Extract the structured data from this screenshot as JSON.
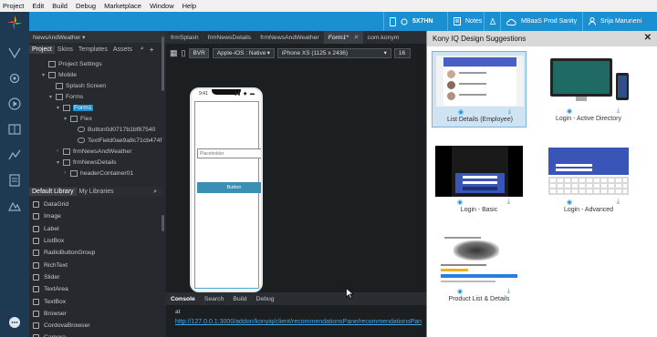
{
  "menubar": [
    "Project",
    "Edit",
    "Build",
    "Debug",
    "Marketplace",
    "Window",
    "Help"
  ],
  "header": {
    "device_code": "5X7HN",
    "notes_label": "Notes",
    "environment": "MBaaS Prod Sanity",
    "user": "Srija Maruneni"
  },
  "project": {
    "name": "NewsAndWeather",
    "tabs": [
      "Project",
      "Skins",
      "Templates",
      "Assets"
    ],
    "tree": [
      {
        "label": "Project Settings",
        "indent": 1,
        "caret": "",
        "icon": "sq"
      },
      {
        "label": "Mobile",
        "indent": 1,
        "caret": "▾",
        "icon": "sq"
      },
      {
        "label": "Splash Screen",
        "indent": 2,
        "caret": "",
        "icon": "sq"
      },
      {
        "label": "Forms",
        "indent": 2,
        "caret": "▾",
        "icon": "sq"
      },
      {
        "label": "Form1",
        "indent": 3,
        "caret": "▾",
        "icon": "sq",
        "selected": true
      },
      {
        "label": "Flex",
        "indent": 4,
        "caret": "▾",
        "icon": "sq"
      },
      {
        "label": "Button0d0717b1bf87540",
        "indent": 5,
        "caret": "",
        "icon": "rnd"
      },
      {
        "label": "TextField0ae9a8c71cb474f",
        "indent": 5,
        "caret": "",
        "icon": "rnd"
      },
      {
        "label": "frmNewsAndWeather",
        "indent": 3,
        "caret": "›",
        "icon": "sq"
      },
      {
        "label": "frmNewsDetails",
        "indent": 3,
        "caret": "▾",
        "icon": "sq"
      },
      {
        "label": "headerContainer01",
        "indent": 4,
        "caret": "›",
        "icon": "sq"
      }
    ]
  },
  "library": {
    "tabs": [
      "Default Library",
      "My Libraries"
    ],
    "items": [
      "DataGrid",
      "Image",
      "Label",
      "ListBox",
      "RadioButtonGroup",
      "RichText",
      "Slider",
      "TextArea",
      "TextBox",
      "Browser",
      "CordovaBrowser",
      "Camera"
    ]
  },
  "editor": {
    "tabs": [
      {
        "label": "frmSplash",
        "active": false
      },
      {
        "label": "frmNewsDetails",
        "active": false
      },
      {
        "label": "frmNewsAndWeather",
        "active": false
      },
      {
        "label": "Form1*",
        "active": true
      },
      {
        "label": "com.konym",
        "active": false
      }
    ],
    "toolbar": {
      "mode": "BVR",
      "platform": "Apple-iOS : Native",
      "device": "iPhone XS (1125 x 2436)",
      "zoom": "16"
    },
    "phone": {
      "time": "9:41",
      "status": "▮▮ ◆ ▬",
      "placeholder": "Placeholder",
      "button": "Button"
    },
    "console_tabs": [
      "Console",
      "Search",
      "Build",
      "Debug"
    ],
    "console_line": "at",
    "console_link": "http://127.0.0.1:3000/addon/konyiq/client/recommendationsPane/recommendationsPan"
  },
  "dialog": {
    "title": "Kony IQ Design Suggestions",
    "close": "✕",
    "cards": [
      {
        "label": "List Details (Employee)"
      },
      {
        "label": "Login - Active Directory"
      },
      {
        "label": "Login - Basic"
      },
      {
        "label": "Login - Advanced"
      },
      {
        "label": "Product List & Details"
      }
    ]
  },
  "colors": {
    "accent": "#1a8fd1",
    "rail": "#1d3a52",
    "panel": "#262a2e",
    "dialog_bg": "#ffffff",
    "selected_card": "#cfe3f3"
  }
}
